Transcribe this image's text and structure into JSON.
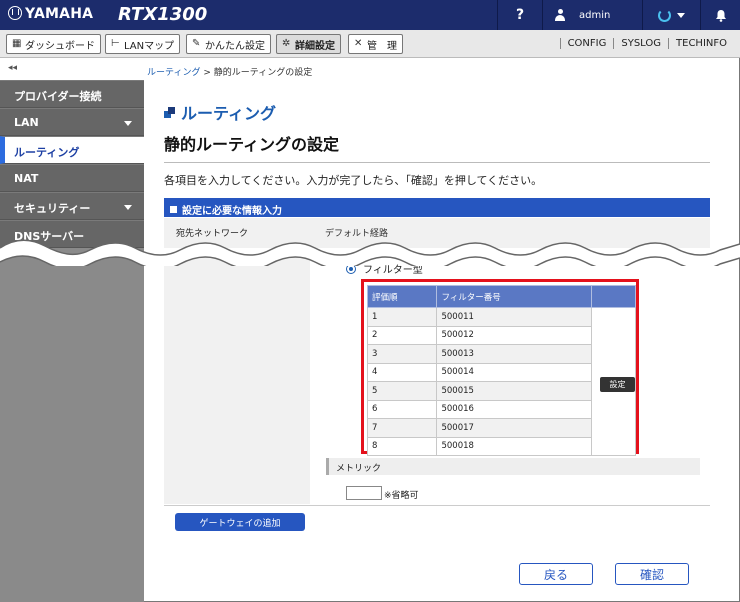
{
  "topbar": {
    "brand": "YAMAHA",
    "model": "RTX1300",
    "help": "?",
    "user": "admin"
  },
  "menu": {
    "dashboard": "ダッシュボード",
    "lanmap": "LANマップ",
    "easy": "かんたん設定",
    "advanced": "詳細設定",
    "manage": "管　理",
    "links": [
      "CONFIG",
      "SYSLOG",
      "TECHINFO"
    ]
  },
  "sidebar": {
    "collapse": "◂◂",
    "items": [
      {
        "label": "プロバイダー接続"
      },
      {
        "label": "LAN"
      },
      {
        "label": "ルーティング"
      },
      {
        "label": "NAT"
      },
      {
        "label": "セキュリティー"
      },
      {
        "label": "DNSサーバー"
      }
    ]
  },
  "breadcrumb": {
    "parent": "ルーティング",
    "sep": " > ",
    "current": "静的ルーティングの設定"
  },
  "section_title": "ルーティング",
  "page_title": "静的ルーティングの設定",
  "instruction": "各項目を入力してください。入力が完了したら、「確認」を押してください。",
  "panel_title": "設定に必要な情報入力",
  "row1": {
    "label": "宛先ネットワーク",
    "value": "デフォルト経路"
  },
  "filter_type": "フィルター型",
  "filter_table": {
    "headers": [
      "評価順",
      "フィルター番号"
    ],
    "rows": [
      [
        "1",
        "500011"
      ],
      [
        "2",
        "500012"
      ],
      [
        "3",
        "500013"
      ],
      [
        "4",
        "500014"
      ],
      [
        "5",
        "500015"
      ],
      [
        "6",
        "500016"
      ],
      [
        "7",
        "500017"
      ],
      [
        "8",
        "500018"
      ]
    ],
    "set_label": "設定"
  },
  "metric": {
    "label": "メトリック",
    "note": "※省略可"
  },
  "gateway_add": "ゲートウェイの追加",
  "buttons": {
    "back": "戻る",
    "confirm": "確認"
  }
}
